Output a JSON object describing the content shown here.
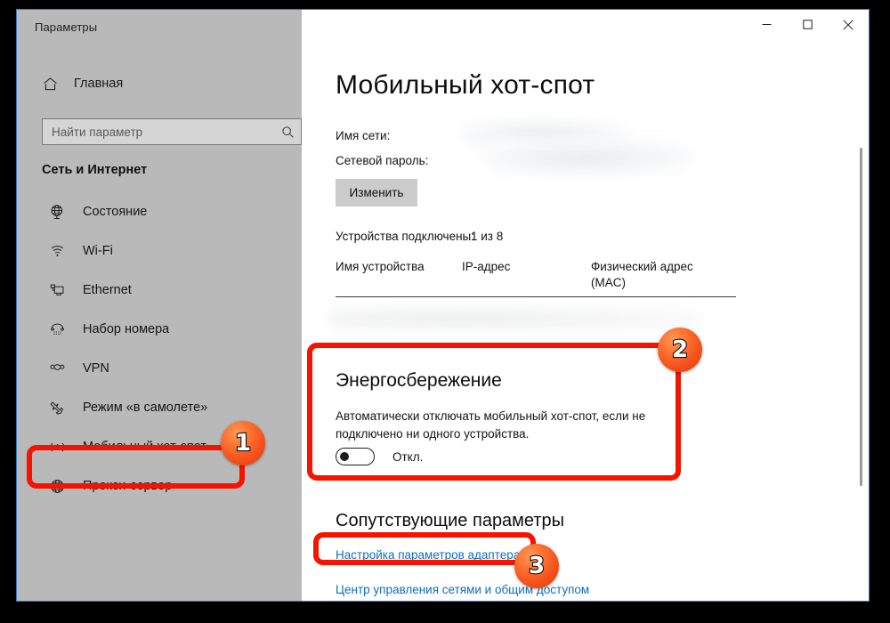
{
  "window": {
    "title": "Параметры",
    "caption_buttons": [
      {
        "name": "minimize",
        "glyph": "—"
      },
      {
        "name": "maximize",
        "glyph": "□"
      },
      {
        "name": "close",
        "glyph": "✕"
      }
    ]
  },
  "sidebar": {
    "home_label": "Главная",
    "home_icon": "home-icon",
    "search": {
      "placeholder": "Найти параметр",
      "value": "",
      "icon": "search-icon"
    },
    "section_heading": "Сеть и Интернет",
    "items": [
      {
        "label": "Состояние",
        "icon": "globe-status-icon",
        "selected": false
      },
      {
        "label": "Wi-Fi",
        "icon": "wifi-icon",
        "selected": false
      },
      {
        "label": "Ethernet",
        "icon": "ethernet-icon",
        "selected": false
      },
      {
        "label": "Набор номера",
        "icon": "dial-up-phone-icon",
        "selected": false
      },
      {
        "label": "VPN",
        "icon": "vpn-icon",
        "selected": false
      },
      {
        "label": "Режим «в самолете»",
        "icon": "airplane-icon",
        "selected": false
      },
      {
        "label": "Мобильный хот-спот",
        "icon": "hotspot-icon",
        "selected": true
      },
      {
        "label": "Прокси-сервер",
        "icon": "proxy-globe-icon",
        "selected": false
      }
    ]
  },
  "main": {
    "page_title": "Мобильный хот-спот",
    "network": {
      "ssid_label": "Имя сети:",
      "password_label": "Сетевой пароль:",
      "ssid_value_redacted": true,
      "password_value_redacted": true,
      "edit_button": "Изменить"
    },
    "devices": {
      "connected_label": "Устройства подключены:",
      "connected_count": "1 из 8",
      "columns": [
        "Имя устройства",
        "IP-адрес",
        "Физический адрес (MAC)"
      ],
      "rows_redacted": true
    },
    "power_saving": {
      "title": "Энергосбережение",
      "description": "Автоматически отключать мобильный хот-спот, если не подключено ни одного устройства.",
      "toggle_state": "Откл.",
      "toggle_on": false
    },
    "related": {
      "title": "Сопутствующие параметры",
      "links": [
        "Настройка параметров адаптера",
        "Центр управления сетями и общим доступом"
      ]
    }
  },
  "annotations": {
    "color": "#f51400",
    "badges": [
      {
        "number": "1",
        "target": "sidebar-item-mobile-hotspot"
      },
      {
        "number": "2",
        "target": "power-saving-section"
      },
      {
        "number": "3",
        "target": "adapter-settings-link"
      }
    ]
  },
  "colors": {
    "sidebar_bg": "#b9b9b9",
    "content_bg": "#ffffff",
    "window_border": "#3b78c8",
    "link": "#0d6ec0",
    "annotation_red": "#f51400",
    "badge_orange": "#f5521c",
    "desktop_bg": "#000000"
  }
}
